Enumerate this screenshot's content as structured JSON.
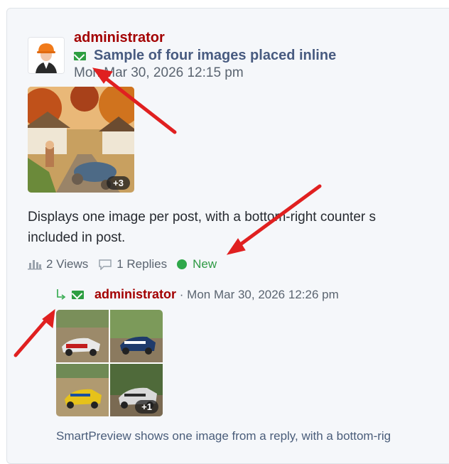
{
  "post": {
    "author": "administrator",
    "title": "Sample of four images placed inline",
    "date": "Mon Mar 30, 2026 12:15 pm",
    "image_counter": "+3",
    "body_line1": "Displays one image per post, with a bottom-right counter s",
    "body_line2": "included in post.",
    "stats": {
      "views": "2 Views",
      "replies": "1 Replies",
      "new": "New"
    }
  },
  "reply": {
    "author": "administrator",
    "separator": "·",
    "date": "Mon Mar 30, 2026 12:26 pm",
    "image_counter": "+1",
    "text": "SmartPreview shows one image from a reply, with a bottom-rig"
  },
  "colors": {
    "author": "#a30000",
    "title": "#485b80",
    "new": "#2f9a44",
    "envelope": "#2d9e41",
    "arrow": "#e02020"
  },
  "icons": {
    "unread": "envelope-icon",
    "views": "bar-chart-icon",
    "replies": "speech-bubble-icon",
    "reply_indicator": "reply-arrow-icon"
  }
}
